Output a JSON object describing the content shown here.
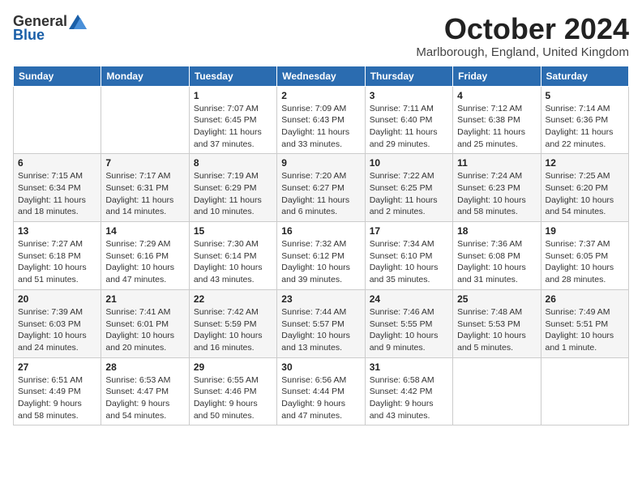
{
  "logo": {
    "general": "General",
    "blue": "Blue"
  },
  "title": "October 2024",
  "location": "Marlborough, England, United Kingdom",
  "days_of_week": [
    "Sunday",
    "Monday",
    "Tuesday",
    "Wednesday",
    "Thursday",
    "Friday",
    "Saturday"
  ],
  "weeks": [
    [
      {
        "day": "",
        "info": ""
      },
      {
        "day": "",
        "info": ""
      },
      {
        "day": "1",
        "info": "Sunrise: 7:07 AM\nSunset: 6:45 PM\nDaylight: 11 hours and 37 minutes."
      },
      {
        "day": "2",
        "info": "Sunrise: 7:09 AM\nSunset: 6:43 PM\nDaylight: 11 hours and 33 minutes."
      },
      {
        "day": "3",
        "info": "Sunrise: 7:11 AM\nSunset: 6:40 PM\nDaylight: 11 hours and 29 minutes."
      },
      {
        "day": "4",
        "info": "Sunrise: 7:12 AM\nSunset: 6:38 PM\nDaylight: 11 hours and 25 minutes."
      },
      {
        "day": "5",
        "info": "Sunrise: 7:14 AM\nSunset: 6:36 PM\nDaylight: 11 hours and 22 minutes."
      }
    ],
    [
      {
        "day": "6",
        "info": "Sunrise: 7:15 AM\nSunset: 6:34 PM\nDaylight: 11 hours and 18 minutes."
      },
      {
        "day": "7",
        "info": "Sunrise: 7:17 AM\nSunset: 6:31 PM\nDaylight: 11 hours and 14 minutes."
      },
      {
        "day": "8",
        "info": "Sunrise: 7:19 AM\nSunset: 6:29 PM\nDaylight: 11 hours and 10 minutes."
      },
      {
        "day": "9",
        "info": "Sunrise: 7:20 AM\nSunset: 6:27 PM\nDaylight: 11 hours and 6 minutes."
      },
      {
        "day": "10",
        "info": "Sunrise: 7:22 AM\nSunset: 6:25 PM\nDaylight: 11 hours and 2 minutes."
      },
      {
        "day": "11",
        "info": "Sunrise: 7:24 AM\nSunset: 6:23 PM\nDaylight: 10 hours and 58 minutes."
      },
      {
        "day": "12",
        "info": "Sunrise: 7:25 AM\nSunset: 6:20 PM\nDaylight: 10 hours and 54 minutes."
      }
    ],
    [
      {
        "day": "13",
        "info": "Sunrise: 7:27 AM\nSunset: 6:18 PM\nDaylight: 10 hours and 51 minutes."
      },
      {
        "day": "14",
        "info": "Sunrise: 7:29 AM\nSunset: 6:16 PM\nDaylight: 10 hours and 47 minutes."
      },
      {
        "day": "15",
        "info": "Sunrise: 7:30 AM\nSunset: 6:14 PM\nDaylight: 10 hours and 43 minutes."
      },
      {
        "day": "16",
        "info": "Sunrise: 7:32 AM\nSunset: 6:12 PM\nDaylight: 10 hours and 39 minutes."
      },
      {
        "day": "17",
        "info": "Sunrise: 7:34 AM\nSunset: 6:10 PM\nDaylight: 10 hours and 35 minutes."
      },
      {
        "day": "18",
        "info": "Sunrise: 7:36 AM\nSunset: 6:08 PM\nDaylight: 10 hours and 31 minutes."
      },
      {
        "day": "19",
        "info": "Sunrise: 7:37 AM\nSunset: 6:05 PM\nDaylight: 10 hours and 28 minutes."
      }
    ],
    [
      {
        "day": "20",
        "info": "Sunrise: 7:39 AM\nSunset: 6:03 PM\nDaylight: 10 hours and 24 minutes."
      },
      {
        "day": "21",
        "info": "Sunrise: 7:41 AM\nSunset: 6:01 PM\nDaylight: 10 hours and 20 minutes."
      },
      {
        "day": "22",
        "info": "Sunrise: 7:42 AM\nSunset: 5:59 PM\nDaylight: 10 hours and 16 minutes."
      },
      {
        "day": "23",
        "info": "Sunrise: 7:44 AM\nSunset: 5:57 PM\nDaylight: 10 hours and 13 minutes."
      },
      {
        "day": "24",
        "info": "Sunrise: 7:46 AM\nSunset: 5:55 PM\nDaylight: 10 hours and 9 minutes."
      },
      {
        "day": "25",
        "info": "Sunrise: 7:48 AM\nSunset: 5:53 PM\nDaylight: 10 hours and 5 minutes."
      },
      {
        "day": "26",
        "info": "Sunrise: 7:49 AM\nSunset: 5:51 PM\nDaylight: 10 hours and 1 minute."
      }
    ],
    [
      {
        "day": "27",
        "info": "Sunrise: 6:51 AM\nSunset: 4:49 PM\nDaylight: 9 hours and 58 minutes."
      },
      {
        "day": "28",
        "info": "Sunrise: 6:53 AM\nSunset: 4:47 PM\nDaylight: 9 hours and 54 minutes."
      },
      {
        "day": "29",
        "info": "Sunrise: 6:55 AM\nSunset: 4:46 PM\nDaylight: 9 hours and 50 minutes."
      },
      {
        "day": "30",
        "info": "Sunrise: 6:56 AM\nSunset: 4:44 PM\nDaylight: 9 hours and 47 minutes."
      },
      {
        "day": "31",
        "info": "Sunrise: 6:58 AM\nSunset: 4:42 PM\nDaylight: 9 hours and 43 minutes."
      },
      {
        "day": "",
        "info": ""
      },
      {
        "day": "",
        "info": ""
      }
    ]
  ]
}
